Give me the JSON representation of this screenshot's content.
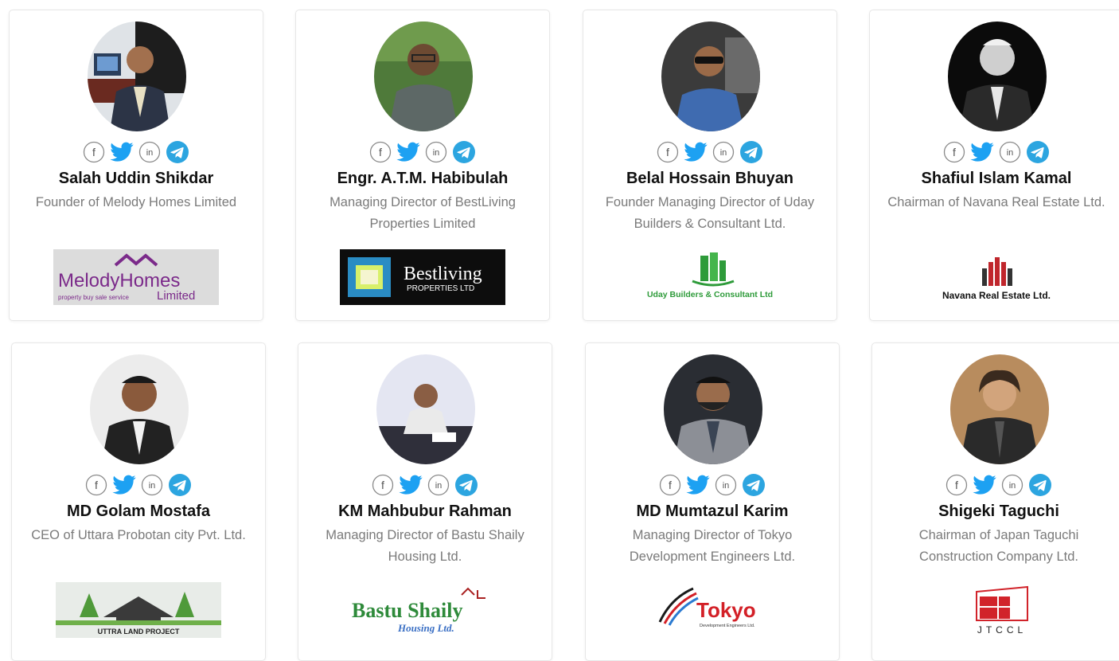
{
  "members": [
    {
      "name": "Salah Uddin Shikdar",
      "role": "Founder of Melody Homes Limited",
      "logo": {
        "main": "MelodyHomes",
        "tagline": "property buy sale service",
        "sub": "Limited"
      }
    },
    {
      "name": "Engr. A.T.M. Habibulah",
      "role": "Managing Director of BestLiving Properties Limited",
      "logo": {
        "main": "Bestliving",
        "sub": "PROPERTIES LTD"
      }
    },
    {
      "name": "Belal Hossain Bhuyan",
      "role": "Founder Managing Director of Uday Builders & Consultant Ltd.",
      "logo": {
        "main": "Uday Builders & Consultant Ltd"
      }
    },
    {
      "name": "Shafiul Islam Kamal",
      "role": "Chairman of Navana Real Estate Ltd.",
      "logo": {
        "main": "Navana Real Estate Ltd."
      }
    },
    {
      "name": "MD Golam Mostafa",
      "role": "CEO of Uttara Probotan city Pvt. Ltd.",
      "logo": {
        "main": "UTTRA LAND PROJECT"
      }
    },
    {
      "name": "KM Mahbubur Rahman",
      "role": "Managing Director of Bastu Shaily Housing Ltd.",
      "logo": {
        "main": "Bastu Shaily",
        "sub": "Housing Ltd."
      }
    },
    {
      "name": "MD Mumtazul Karim",
      "role": "Managing Director of Tokyo Development Engineers Ltd.",
      "logo": {
        "main": "Tokyo",
        "sub": "Development Engineers Ltd."
      }
    },
    {
      "name": "Shigeki Taguchi",
      "role": "Chairman of Japan Taguchi Construction Company Ltd.",
      "logo": {
        "main": "JTCCL"
      }
    }
  ],
  "social": {
    "icons": [
      "facebook-icon",
      "twitter-icon",
      "linkedin-icon",
      "telegram-icon"
    ],
    "facebook_glyph": "f",
    "linkedin_glyph": "in",
    "colors": {
      "outline": "#8a8a8a",
      "twitter": "#1da1f2",
      "telegram": "#2ca5e0"
    }
  },
  "colors": {
    "name": "#111111",
    "role": "#7a7a7a",
    "card_border": "#e7e7e7",
    "melody": "#7b2a8a",
    "bestliving_bg": "#0d0d0d",
    "uday_green": "#2e9b3a",
    "navana_red": "#c0262c",
    "tokyo_red": "#d32027",
    "jtccl_red": "#d1232a"
  }
}
